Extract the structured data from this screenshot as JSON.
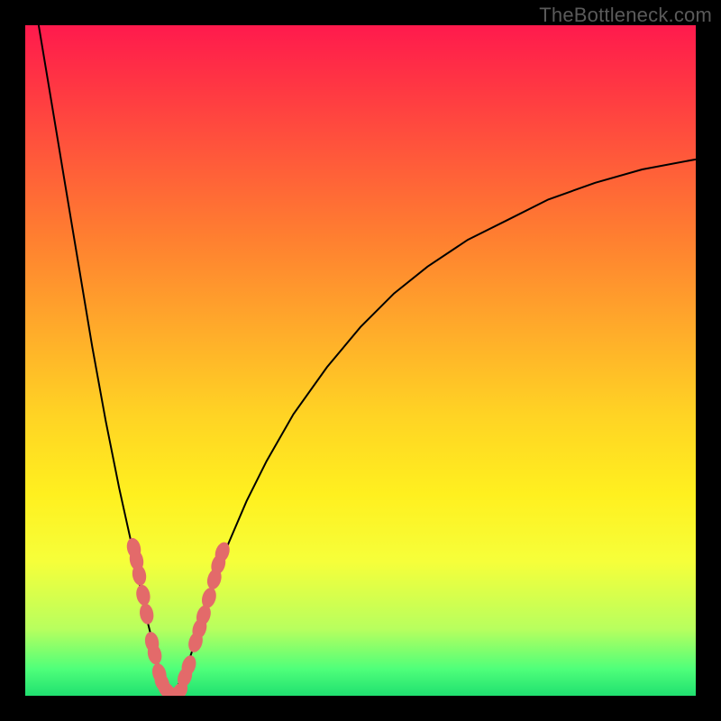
{
  "watermark": "TheBottleneck.com",
  "colors": {
    "frame": "#000000",
    "gradient_top": "#ff1a4d",
    "gradient_bottom": "#20e070",
    "curve": "#000000",
    "bead": "#e36a6a"
  },
  "chart_data": {
    "type": "line",
    "title": "",
    "xlabel": "",
    "ylabel": "",
    "xlim": [
      0,
      100
    ],
    "ylim": [
      0,
      100
    ],
    "grid": false,
    "legend": false,
    "series": [
      {
        "name": "left-branch",
        "x": [
          2,
          4,
          6,
          8,
          10,
          12,
          14,
          16,
          18,
          19,
          20,
          21,
          22
        ],
        "values": [
          100,
          88,
          76,
          64,
          52,
          41,
          31,
          22,
          12,
          8,
          4,
          1,
          0
        ]
      },
      {
        "name": "right-branch",
        "x": [
          22,
          24,
          26,
          28,
          30,
          33,
          36,
          40,
          45,
          50,
          55,
          60,
          66,
          72,
          78,
          85,
          92,
          100
        ],
        "values": [
          0,
          4,
          10,
          16,
          22,
          29,
          35,
          42,
          49,
          55,
          60,
          64,
          68,
          71,
          74,
          76.5,
          78.5,
          80
        ]
      }
    ],
    "annotations": {
      "beads_note": "salmon beads along lower V region of curve (approx positions in chart coords)",
      "beads": [
        {
          "x": 16.2,
          "y": 22.0
        },
        {
          "x": 16.6,
          "y": 20.2
        },
        {
          "x": 17.0,
          "y": 18.0
        },
        {
          "x": 17.6,
          "y": 15.0
        },
        {
          "x": 18.1,
          "y": 12.2
        },
        {
          "x": 18.9,
          "y": 8.0
        },
        {
          "x": 19.3,
          "y": 6.2
        },
        {
          "x": 20.0,
          "y": 3.3
        },
        {
          "x": 20.4,
          "y": 2.0
        },
        {
          "x": 21.1,
          "y": 0.8
        },
        {
          "x": 22.0,
          "y": 0.2
        },
        {
          "x": 23.0,
          "y": 0.6
        },
        {
          "x": 23.8,
          "y": 2.8
        },
        {
          "x": 24.4,
          "y": 4.5
        },
        {
          "x": 25.4,
          "y": 8.0
        },
        {
          "x": 26.0,
          "y": 10.0
        },
        {
          "x": 26.6,
          "y": 12.0
        },
        {
          "x": 27.4,
          "y": 14.6
        },
        {
          "x": 28.2,
          "y": 17.4
        },
        {
          "x": 28.8,
          "y": 19.6
        },
        {
          "x": 29.4,
          "y": 21.4
        }
      ]
    }
  }
}
